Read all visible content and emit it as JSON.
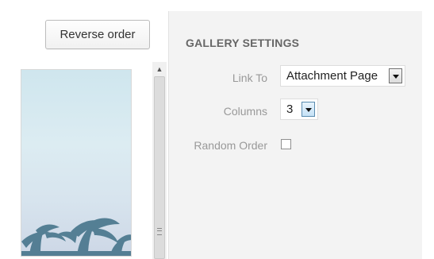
{
  "toolbar": {
    "reverse_order_label": "Reverse order"
  },
  "gallery_settings": {
    "title": "GALLERY SETTINGS",
    "link_to": {
      "label": "Link To",
      "value": "Attachment Page"
    },
    "columns": {
      "label": "Columns",
      "value": "3"
    },
    "random_order": {
      "label": "Random Order",
      "checked": false
    }
  },
  "icons": {
    "scroll_up": "scroll-up-arrow-icon",
    "dropdown": "chevron-down-icon",
    "grip": "scroll-grip-icon"
  },
  "colors": {
    "panel_bg": "#f3f3f3",
    "title": "#666666",
    "label": "#999999"
  }
}
